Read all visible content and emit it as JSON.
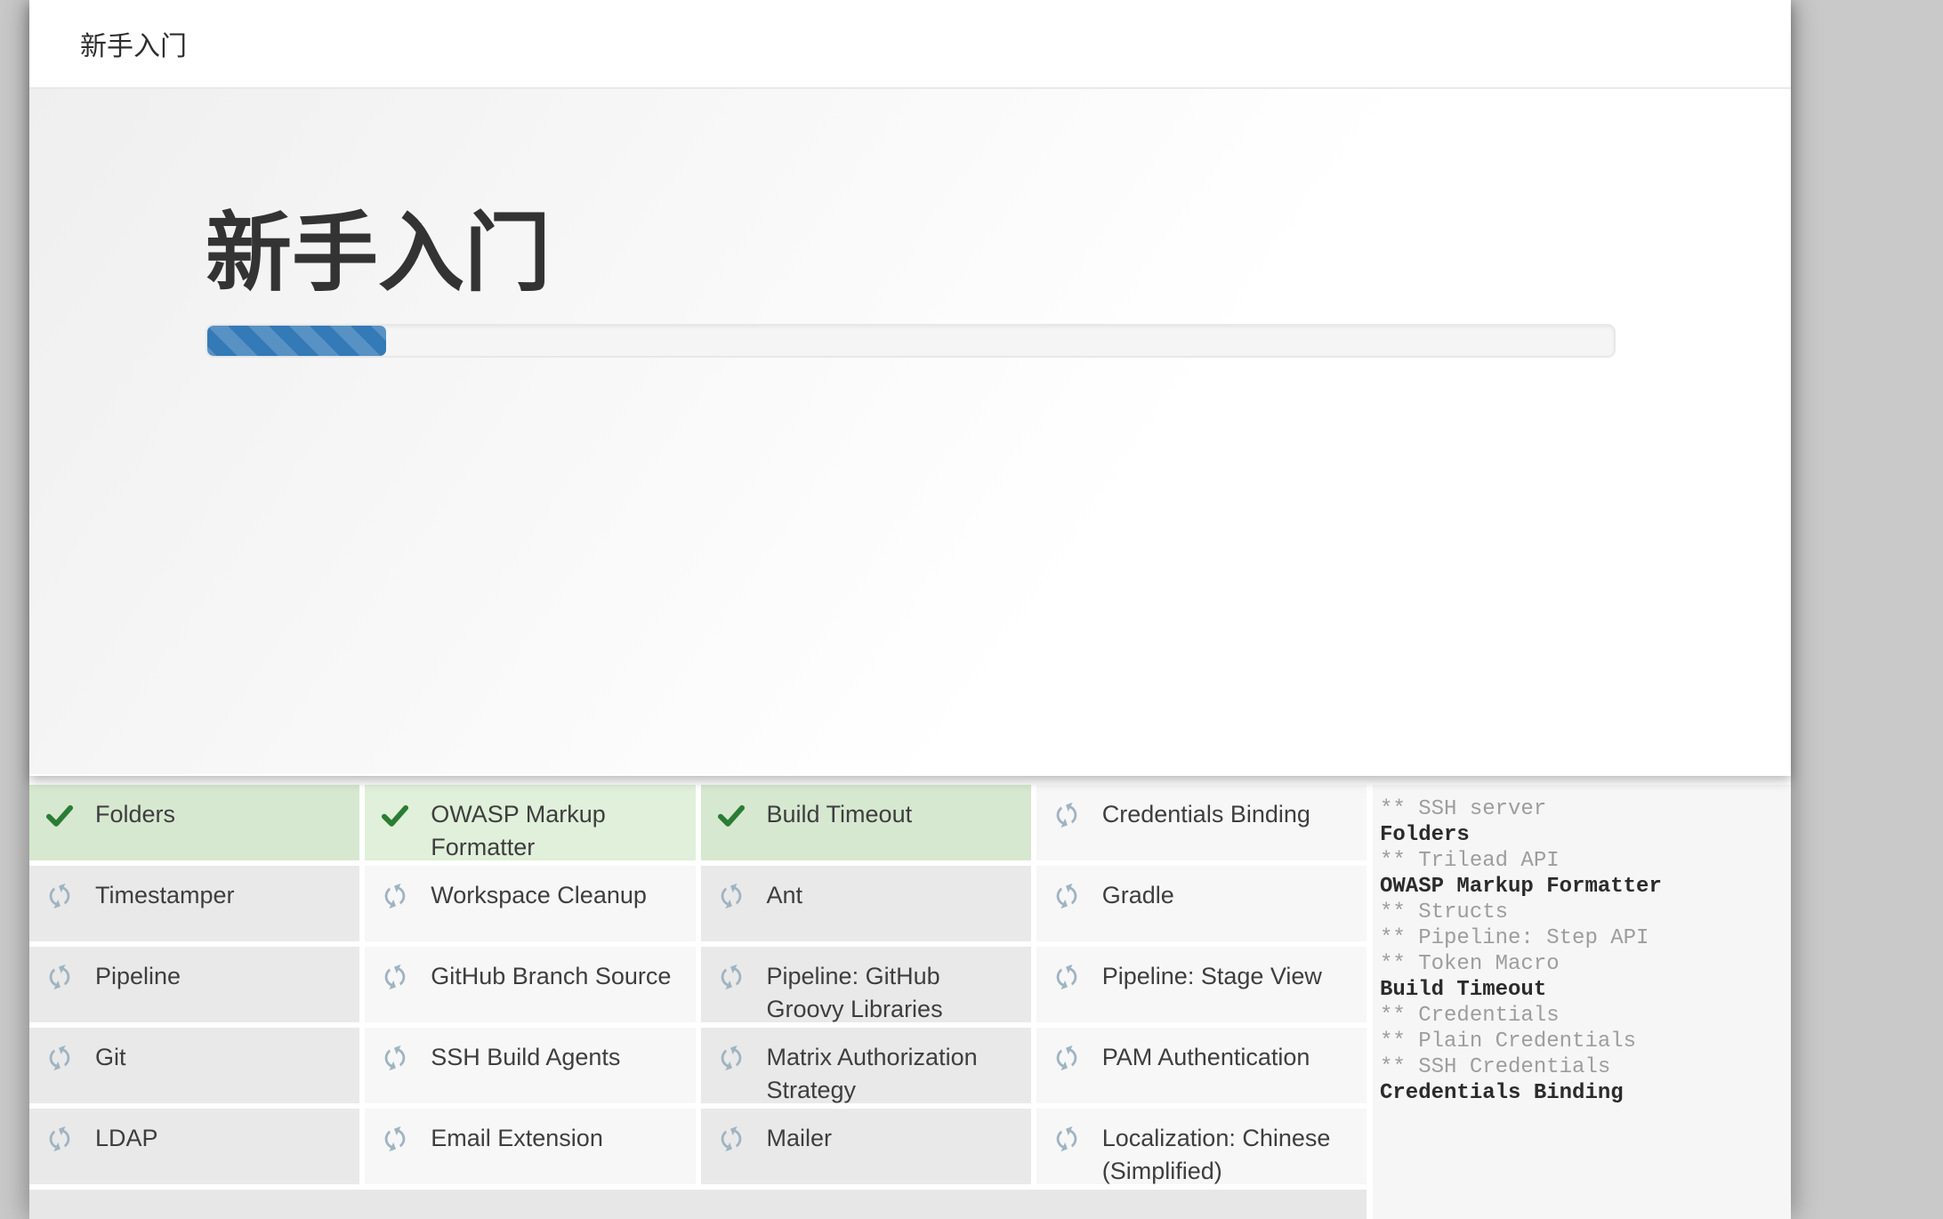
{
  "window": {
    "header_title": "新手入门"
  },
  "hero": {
    "title": "新手入门",
    "progress_percent": 12.7
  },
  "plugins": {
    "rows": [
      [
        {
          "label": "Folders",
          "status": "installed"
        },
        {
          "label": "OWASP Markup Formatter",
          "status": "installed"
        },
        {
          "label": "Build Timeout",
          "status": "installed"
        },
        {
          "label": "Credentials Binding",
          "status": "pending"
        }
      ],
      [
        {
          "label": "Timestamper",
          "status": "pending"
        },
        {
          "label": "Workspace Cleanup",
          "status": "pending"
        },
        {
          "label": "Ant",
          "status": "pending"
        },
        {
          "label": "Gradle",
          "status": "pending"
        }
      ],
      [
        {
          "label": "Pipeline",
          "status": "pending"
        },
        {
          "label": "GitHub Branch Source",
          "status": "pending"
        },
        {
          "label": "Pipeline: GitHub Groovy Libraries",
          "status": "pending"
        },
        {
          "label": "Pipeline: Stage View",
          "status": "pending"
        }
      ],
      [
        {
          "label": "Git",
          "status": "pending"
        },
        {
          "label": "SSH Build Agents",
          "status": "pending"
        },
        {
          "label": "Matrix Authorization Strategy",
          "status": "pending"
        },
        {
          "label": "PAM Authentication",
          "status": "pending"
        }
      ],
      [
        {
          "label": "LDAP",
          "status": "pending"
        },
        {
          "label": "Email Extension",
          "status": "pending"
        },
        {
          "label": "Mailer",
          "status": "pending"
        },
        {
          "label": "Localization: Chinese (Simplified)",
          "status": "pending"
        }
      ]
    ]
  },
  "log": {
    "lines": [
      {
        "text": "** SSH server",
        "style": "dep"
      },
      {
        "text": "Folders",
        "style": "installed"
      },
      {
        "text": "** Trilead API",
        "style": "dep"
      },
      {
        "text": "OWASP Markup Formatter",
        "style": "installed"
      },
      {
        "text": "** Structs",
        "style": "dep"
      },
      {
        "text": "** Pipeline: Step API",
        "style": "dep"
      },
      {
        "text": "** Token Macro",
        "style": "dep"
      },
      {
        "text": "Build Timeout",
        "style": "installed"
      },
      {
        "text": "** Credentials",
        "style": "dep"
      },
      {
        "text": "** Plain Credentials",
        "style": "dep"
      },
      {
        "text": "** SSH Credentials",
        "style": "dep"
      },
      {
        "text": "Credentials Binding",
        "style": "installed"
      }
    ]
  },
  "colors": {
    "progress_accent": "#337ab7",
    "check_green": "#2a7d33",
    "cell_done_odd": "#d6e8d0",
    "cell_done_even": "#e0f0da",
    "cell_pending_odd": "#e9e9e9",
    "cell_pending_even": "#f7f7f7",
    "spinner_blue": "#9fb4c2",
    "page_background": "#c9c9c9"
  },
  "icons": {
    "installed": "check-icon",
    "pending": "sync-spinner-icon"
  }
}
